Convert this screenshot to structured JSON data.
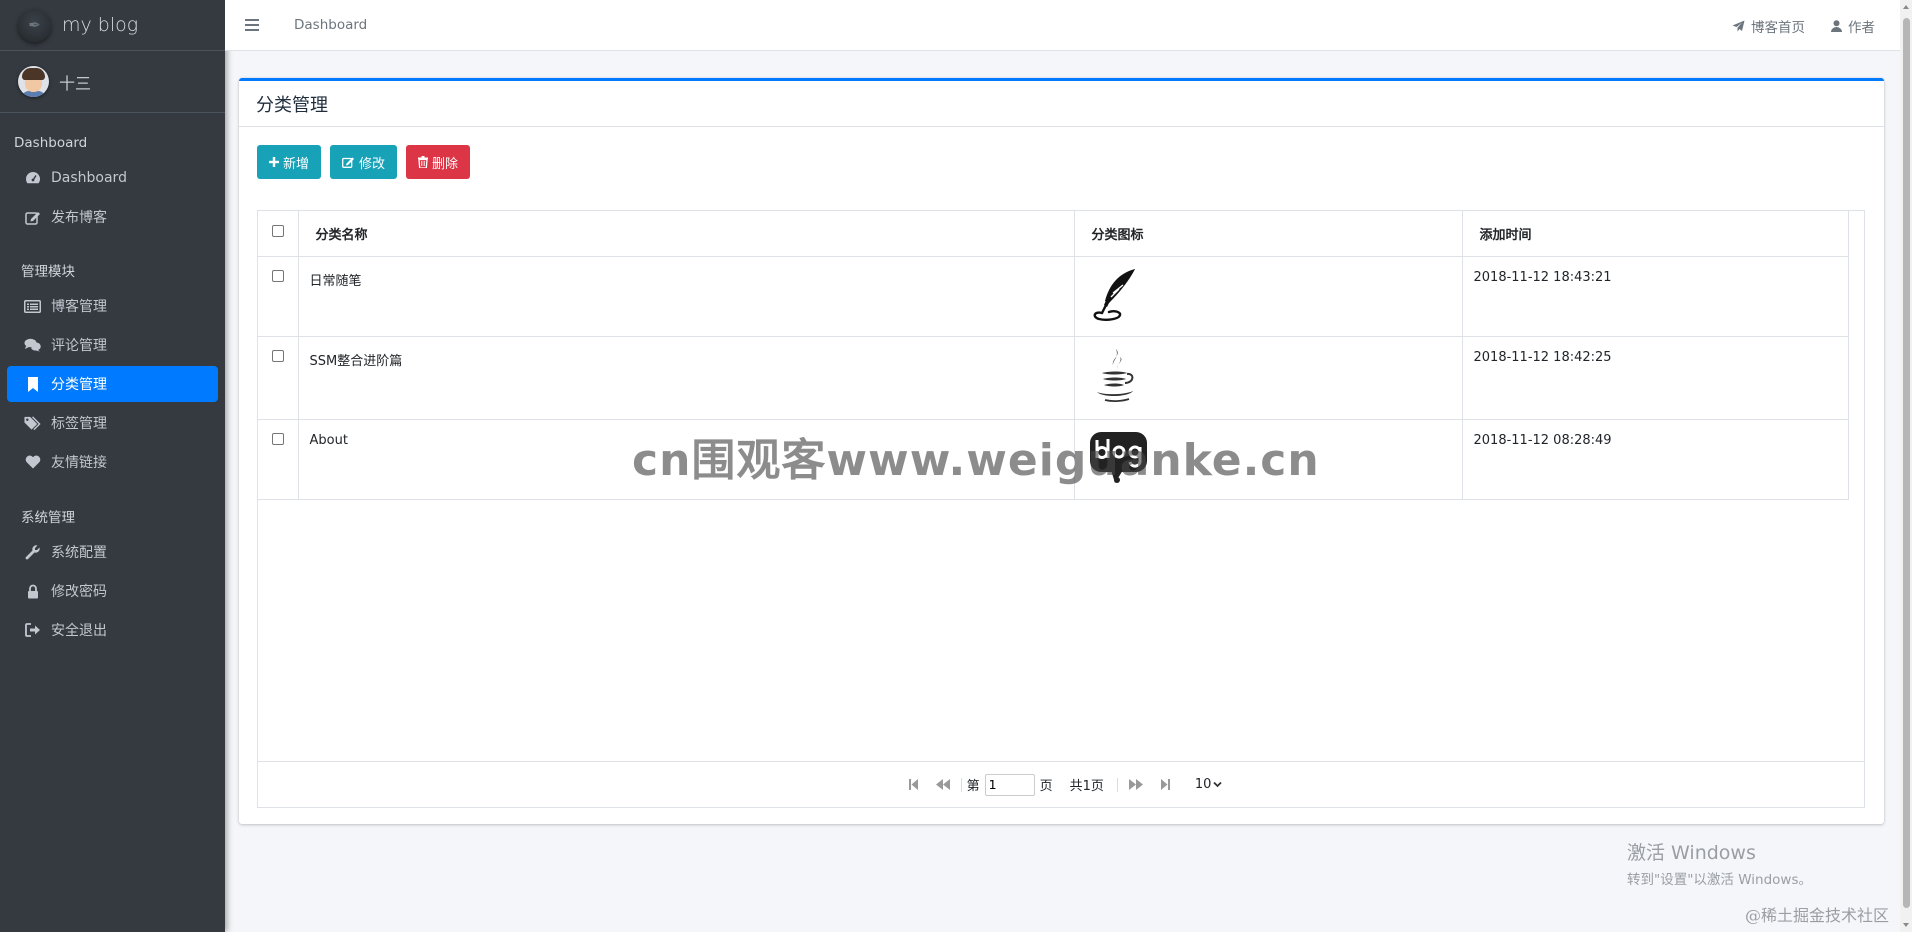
{
  "brand": {
    "name": "my blog"
  },
  "user": {
    "name": "十三"
  },
  "sidebar": {
    "sections": [
      {
        "header": "Dashboard",
        "items": [
          {
            "label": "Dashboard",
            "icon": "dashboard-icon"
          },
          {
            "label": "发布博客",
            "icon": "edit-icon"
          }
        ]
      },
      {
        "header": "管理模块",
        "items": [
          {
            "label": "博客管理",
            "icon": "list-icon"
          },
          {
            "label": "评论管理",
            "icon": "comments-icon"
          },
          {
            "label": "分类管理",
            "icon": "bookmark-icon",
            "active": true
          },
          {
            "label": "标签管理",
            "icon": "tags-icon"
          },
          {
            "label": "友情链接",
            "icon": "heart-icon"
          }
        ]
      },
      {
        "header": "系统管理",
        "items": [
          {
            "label": "系统配置",
            "icon": "wrench-icon"
          },
          {
            "label": "修改密码",
            "icon": "lock-icon"
          },
          {
            "label": "安全退出",
            "icon": "sign-out-icon"
          }
        ]
      }
    ]
  },
  "navbar": {
    "breadcrumb": "Dashboard",
    "home_link": "博客首页",
    "author_link": "作者"
  },
  "card": {
    "title": "分类管理",
    "buttons": {
      "add": "新增",
      "edit": "修改",
      "delete": "删除"
    }
  },
  "table": {
    "columns": [
      "分类名称",
      "分类图标",
      "添加时间"
    ],
    "rows": [
      {
        "name": "日常随笔",
        "icon": "feather-icon",
        "time": "2018-11-12 18:43:21"
      },
      {
        "name": "SSM整合进阶篇",
        "icon": "java-icon",
        "time": "2018-11-12 18:42:25"
      },
      {
        "name": "About",
        "icon": "blog-bubble-icon",
        "time": "2018-11-12 08:28:49"
      }
    ]
  },
  "pager": {
    "page_prefix": "第",
    "page_value": "1",
    "page_suffix": "页",
    "total": "共1页",
    "page_size": "10"
  },
  "overlays": {
    "watermark": "cn围观客www.weiguanke.cn",
    "activate_title": "激活 Windows",
    "activate_hint": "转到\"设置\"以激活 Windows。",
    "corner_mark": "@稀土掘金技术社区"
  },
  "colors": {
    "sidebar_bg": "#343a40",
    "active_item": "#007bff",
    "info_button": "#17a2b8",
    "danger_button": "#dc3545"
  }
}
